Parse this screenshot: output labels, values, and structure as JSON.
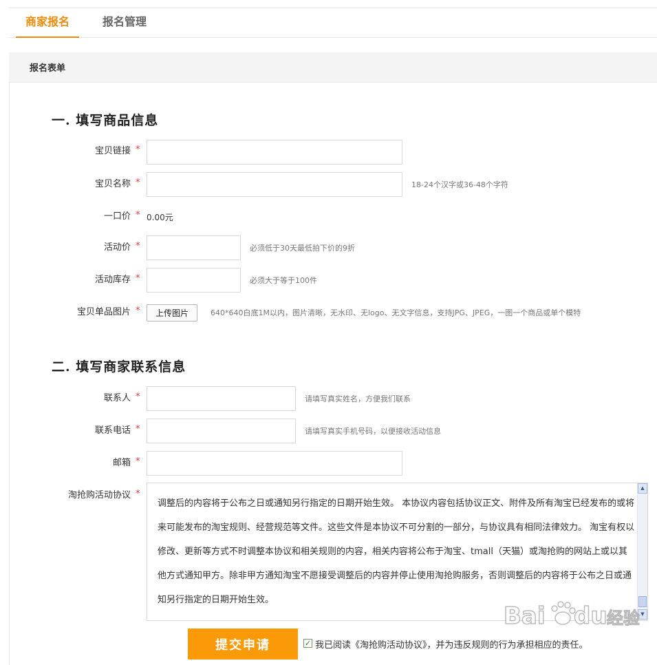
{
  "tabs": [
    {
      "label": "商家报名",
      "active": true
    },
    {
      "label": "报名管理",
      "active": false
    }
  ],
  "form_header": "报名表单",
  "section1": {
    "title": "一. 填写商品信息",
    "fields": {
      "item_link": {
        "label": "宝贝链接",
        "value": ""
      },
      "item_name": {
        "label": "宝贝名称",
        "value": "",
        "hint": "18-24个汉字或36-48个字符"
      },
      "fixed_price": {
        "label": "一口价",
        "value": "0.00元"
      },
      "event_price": {
        "label": "活动价",
        "value": "",
        "hint": "必须低于30天最低拍下价的9折"
      },
      "event_stock": {
        "label": "活动库存",
        "value": "",
        "hint": "必须大于等于100件"
      },
      "item_image": {
        "label": "宝贝单品图片",
        "button": "上传图片",
        "hint": "640*640白底1M以内，图片清晰，无水印、无logo、无文字信息，支持JPG、JPEG，一图一个商品或单个模特"
      }
    }
  },
  "section2": {
    "title": "二. 填写商家联系信息",
    "fields": {
      "contact": {
        "label": "联系人",
        "value": "",
        "hint": "请填写真实姓名，方便我们联系"
      },
      "phone": {
        "label": "联系电话",
        "value": "",
        "hint": "请填写真实手机号码，以便接收活动信息"
      },
      "email": {
        "label": "邮箱",
        "value": ""
      },
      "agreement": {
        "label": "淘抢购活动协议",
        "text": "调整后的内容将于公布之日或通知另行指定的日期开始生效。 本协议内容包括协议正文、附件及所有淘宝已经发布的或将来可能发布的淘宝规则、经营规范等文件。这些文件是本协议不可分割的一部分，与协议具有相同法律效力。 淘宝有权以修改、更新等方式不时调整本协议和相关规则的内容，相关内容将公布于淘宝、tmall（天猫）或淘抢购的网站上或以其他方式通知甲方。除非甲方通知淘宝不愿接受调整后的内容并停止使用淘抢购服务，否则调整后的内容将于公布之日或通知另行指定的日期开始生效。"
      }
    }
  },
  "required_mark": "*",
  "submit_label": "提交申请",
  "agree": {
    "checked": true,
    "check_glyph": "✓",
    "text": "我已阅读《淘抢购活动协议》，并为违反规则的行为承担相应的责任。"
  },
  "watermark": {
    "brand": "Bai",
    "brand2": "du",
    "suffix": "经验"
  },
  "colors": {
    "accent": "#f08a0c",
    "submit": "#fb9a08",
    "required": "#e33333"
  }
}
